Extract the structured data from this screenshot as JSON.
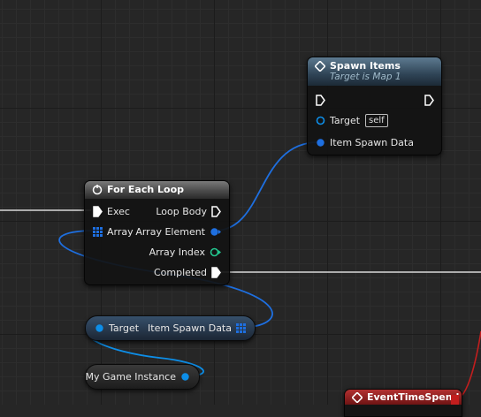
{
  "canvas": {
    "background": "#262626"
  },
  "colors": {
    "exec_wire": "#d8d8d8",
    "struct_pin": "#1e6fe0",
    "object_pin": "#0d8ee8",
    "int_pin": "#23c78f",
    "func_header": "#35506a",
    "event_header": "#9c1f1f"
  },
  "spawn_items": {
    "title": "Spawn Items",
    "subtitle": "Target is Map 1",
    "icon": "function-icon",
    "target_label": "Target",
    "target_default": "self",
    "item_spawn_data_label": "Item Spawn Data"
  },
  "for_each_loop": {
    "title": "For Each Loop",
    "icon": "loop-macro-icon",
    "exec_label": "Exec",
    "array_label": "Array",
    "loop_body_label": "Loop Body",
    "array_element_label": "Array Element",
    "array_index_label": "Array Index",
    "completed_label": "Completed"
  },
  "break_struct": {
    "target_label": "Target",
    "item_spawn_data_label": "Item Spawn Data"
  },
  "game_instance": {
    "label": "My Game Instance"
  },
  "event_node": {
    "title": "EventTimeSpend",
    "icon": "event-diamond-icon"
  }
}
